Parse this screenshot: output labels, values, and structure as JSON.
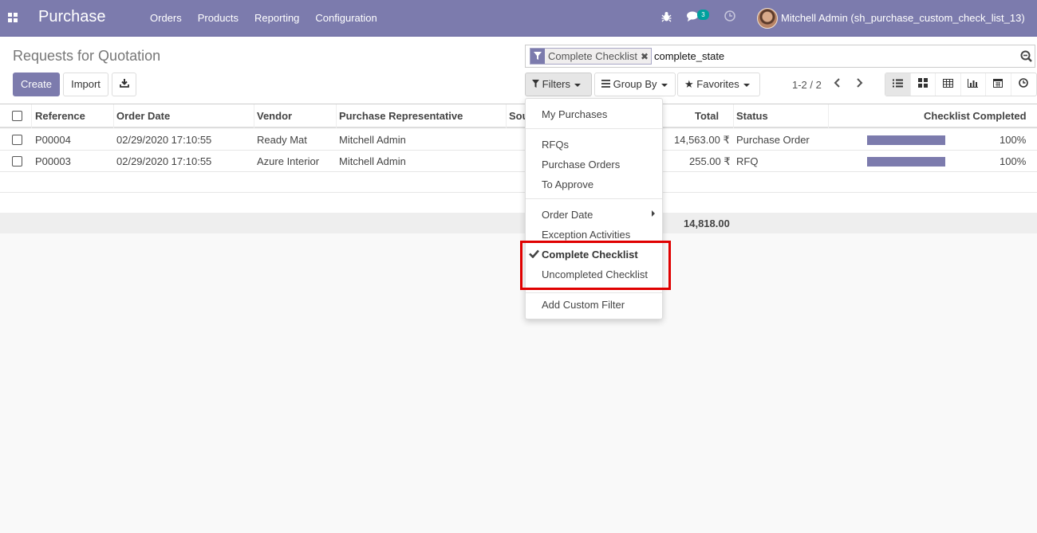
{
  "navbar": {
    "app_name": "Purchase",
    "menus": [
      "Orders",
      "Products",
      "Reporting",
      "Configuration"
    ],
    "messages_count": "3",
    "user": "Mitchell Admin (sh_purchase_custom_check_list_13)",
    "color": "#7c7bad"
  },
  "control_panel": {
    "title": "Requests for Quotation",
    "create_label": "Create",
    "import_label": "Import",
    "search": {
      "facet_label": "Complete Checklist",
      "query": "complete_state"
    },
    "filters_label": "Filters",
    "groupby_label": "Group By",
    "favorites_label": "Favorites",
    "pager": "1-2 / 2",
    "views": [
      "list-icon",
      "kanban-icon",
      "pivot-icon",
      "graph-icon",
      "calendar-icon",
      "activity-icon"
    ]
  },
  "table": {
    "columns": [
      "Reference",
      "Order Date",
      "Vendor",
      "Purchase Representative",
      "Sou",
      "Total",
      "Status",
      "Checklist Completed"
    ],
    "rows": [
      {
        "reference": "P00004",
        "order_date": "02/29/2020 17:10:55",
        "vendor": "Ready Mat",
        "rep": "Mitchell Admin",
        "total": "14,563.00 ₹",
        "status": "Purchase Order",
        "checklist": "100%",
        "checklist_value": 1.0
      },
      {
        "reference": "P00003",
        "order_date": "02/29/2020 17:10:55",
        "vendor": "Azure Interior",
        "rep": "Mitchell Admin",
        "total": "255.00 ₹",
        "status": "RFQ",
        "checklist": "100%",
        "checklist_value": 1.0
      }
    ],
    "footer_total": "14,818.00"
  },
  "filters_menu": {
    "group1": [
      "My Purchases"
    ],
    "group2": [
      "RFQs",
      "Purchase Orders",
      "To Approve"
    ],
    "group3": [
      "Order Date",
      "Exception Activities"
    ],
    "checklist_filters": [
      {
        "label": "Complete Checklist",
        "checked": true
      },
      {
        "label": "Uncompleted Checklist",
        "checked": false
      }
    ],
    "custom_filter": "Add Custom Filter",
    "highlight_color": "#e00000"
  }
}
